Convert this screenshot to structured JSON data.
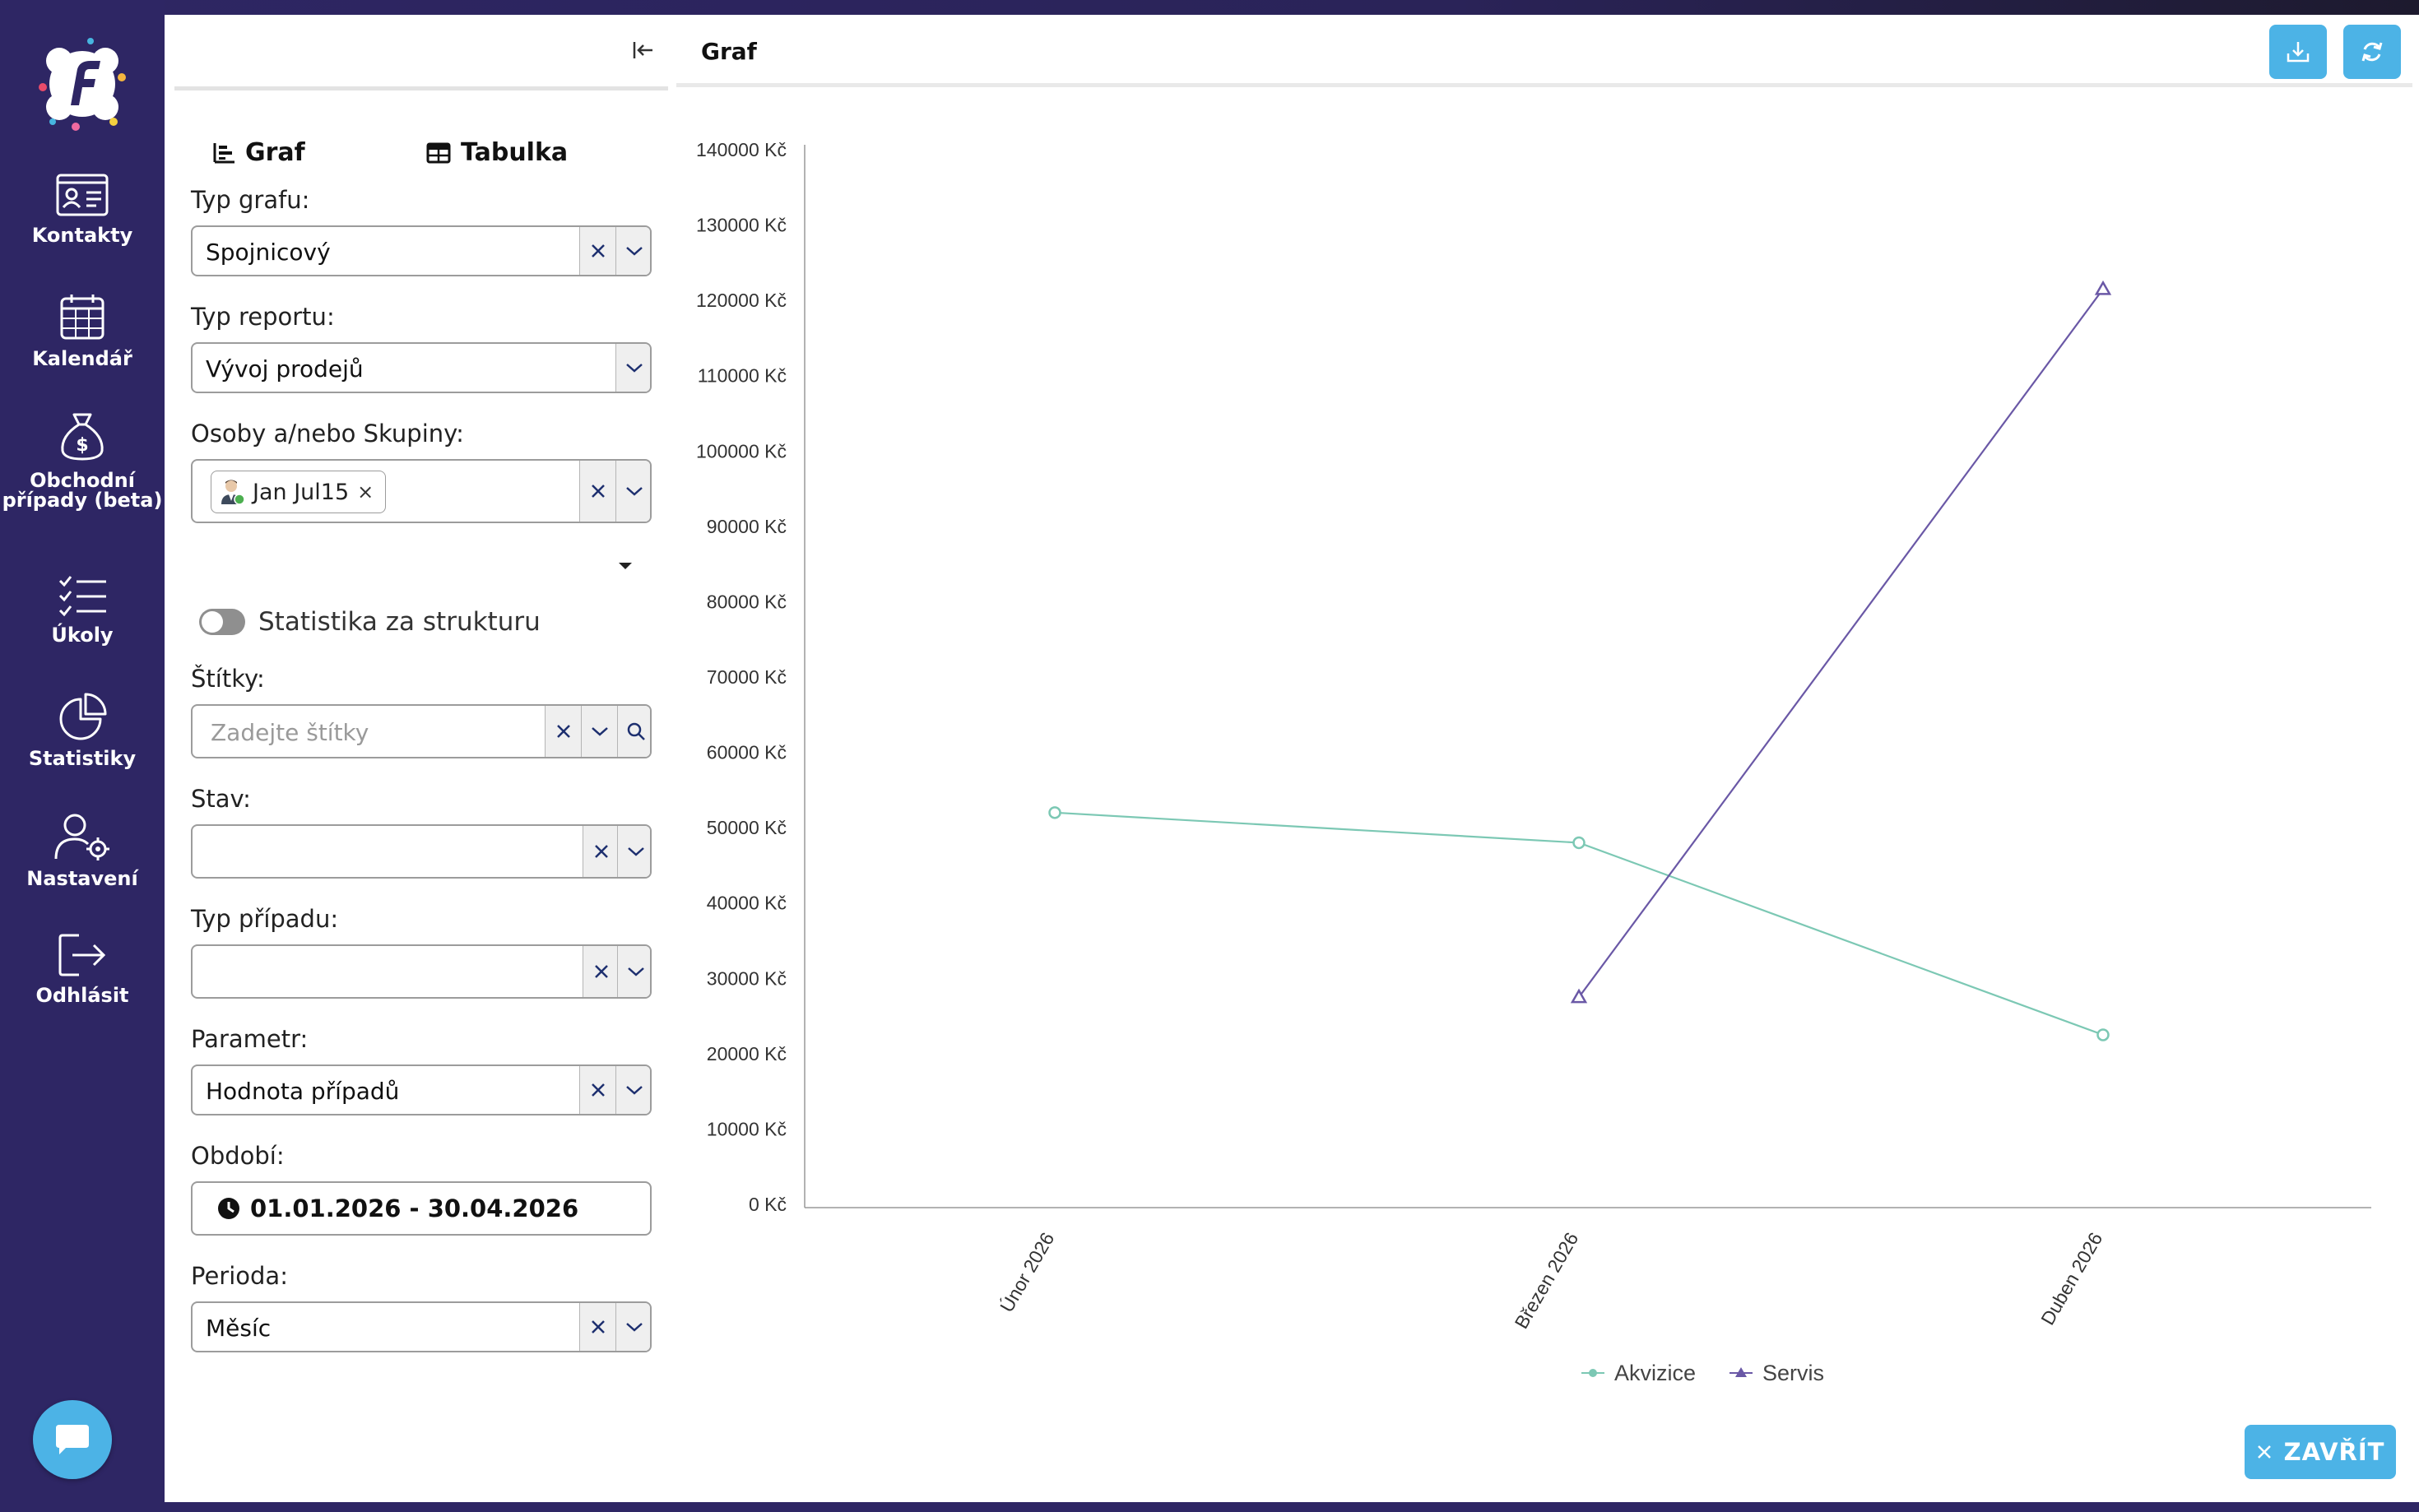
{
  "nav": {
    "items": [
      {
        "label": "Kontakty",
        "icon": "contact-card-icon"
      },
      {
        "label": "Kalendář",
        "icon": "calendar-icon"
      },
      {
        "label": "Obchodní případy (beta)",
        "icon": "money-bag-icon"
      },
      {
        "label": "Úkoly",
        "icon": "task-list-icon"
      },
      {
        "label": "Statistiky",
        "icon": "pie-chart-icon"
      },
      {
        "label": "Nastavení",
        "icon": "user-gear-icon"
      },
      {
        "label": "Odhlásit",
        "icon": "logout-icon"
      }
    ]
  },
  "filters": {
    "tabs": {
      "graph": "Graf",
      "table": "Tabulka"
    },
    "chart_type": {
      "label": "Typ grafu:",
      "value": "Spojnicový"
    },
    "report_type": {
      "label": "Typ reportu:",
      "value": "Vývoj prodejů"
    },
    "persons": {
      "label": "Osoby a/nebo Skupiny:",
      "chip": "Jan Jul15"
    },
    "structure_toggle": {
      "label": "Statistika za strukturu",
      "on": false
    },
    "tags": {
      "label": "Štítky:",
      "placeholder": "Zadejte štítky"
    },
    "state": {
      "label": "Stav:",
      "value": ""
    },
    "case_type": {
      "label": "Typ případu:",
      "value": ""
    },
    "parameter": {
      "label": "Parametr:",
      "value": "Hodnota případů"
    },
    "period_range": {
      "label": "Období:",
      "value": "01.01.2026 - 30.04.2026"
    },
    "period": {
      "label": "Perioda:",
      "value": "Měsíc"
    }
  },
  "chart_panel": {
    "title": "Graf",
    "close_label": "ZAVŘÍT"
  },
  "colors": {
    "sidebar": "#2e2664",
    "accent": "#4cb3e6",
    "akvizice": "#7cc8b4",
    "servis": "#6a58a6"
  },
  "chart_data": {
    "type": "line",
    "categories": [
      "Únor 2026",
      "Březen 2026",
      "Duben 2026"
    ],
    "series": [
      {
        "name": "Akvizice",
        "values": [
          52000,
          48000,
          22500
        ],
        "marker": "circle"
      },
      {
        "name": "Servis",
        "values": [
          null,
          27500,
          121500
        ],
        "marker": "triangle"
      }
    ],
    "ylim": [
      0,
      140000
    ],
    "yticks": [
      "0 Kč",
      "10000 Kč",
      "20000 Kč",
      "30000 Kč",
      "40000 Kč",
      "50000 Kč",
      "60000 Kč",
      "70000 Kč",
      "80000 Kč",
      "90000 Kč",
      "100000 Kč",
      "110000 Kč",
      "120000 Kč",
      "130000 Kč",
      "140000 Kč"
    ],
    "legend_position": "bottom-center",
    "grid": false
  }
}
